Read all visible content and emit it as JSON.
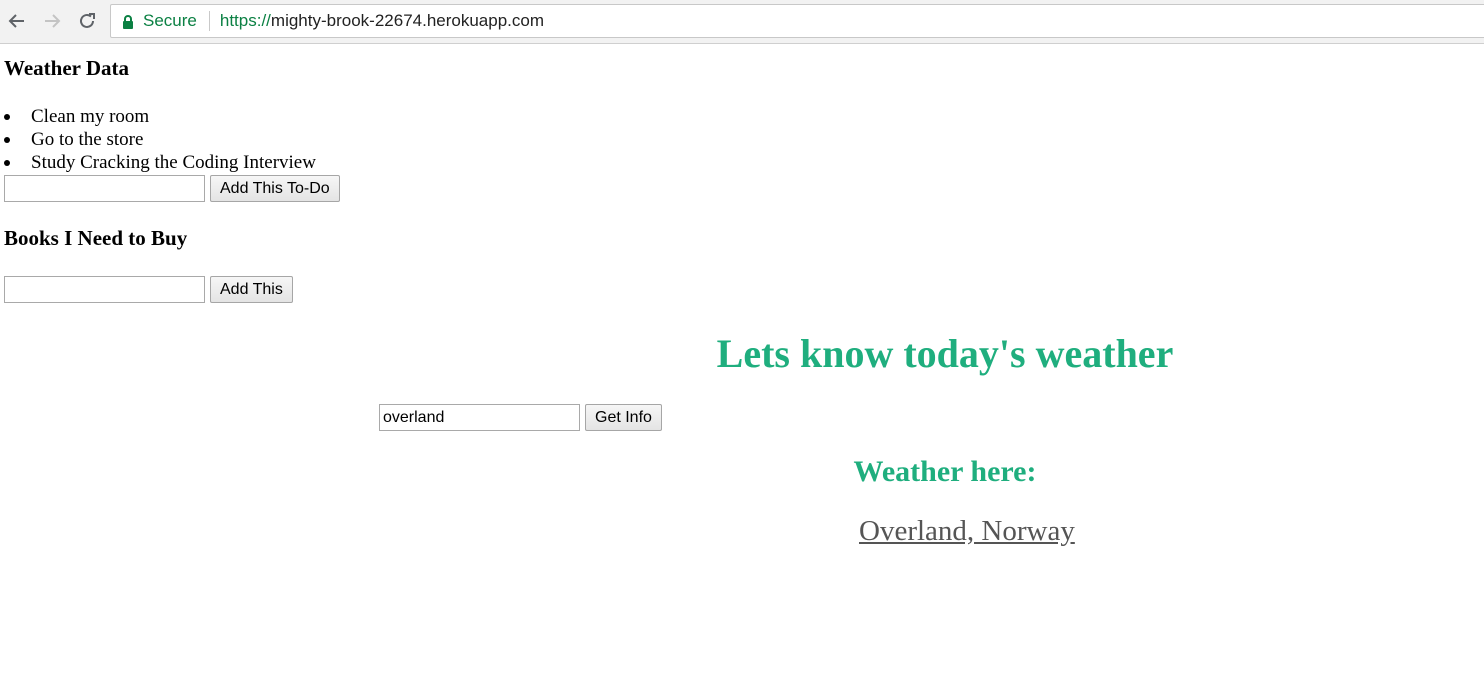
{
  "browser": {
    "security_label": "Secure",
    "url_protocol": "https://",
    "url_host": "mighty-brook-22674.herokuapp.com",
    "nav_icons": [
      "back-icon",
      "forward-icon",
      "reload-icon",
      "lock-icon"
    ]
  },
  "todo_section": {
    "heading": "Weather Data",
    "items": [
      "Clean my room",
      "Go to the store",
      "Study Cracking the Coding Interview"
    ],
    "input_value": "",
    "add_button_label": "Add This To-Do"
  },
  "books_section": {
    "heading": "Books I Need to Buy",
    "input_value": "",
    "add_button_label": "Add This"
  },
  "weather": {
    "title": "Lets know today's weather",
    "search_value": "overland",
    "get_info_label": "Get Info",
    "result_heading": "Weather here:",
    "location": "Overland, Norway",
    "accent_color": "#1fae7e",
    "link_color": "#555555"
  }
}
